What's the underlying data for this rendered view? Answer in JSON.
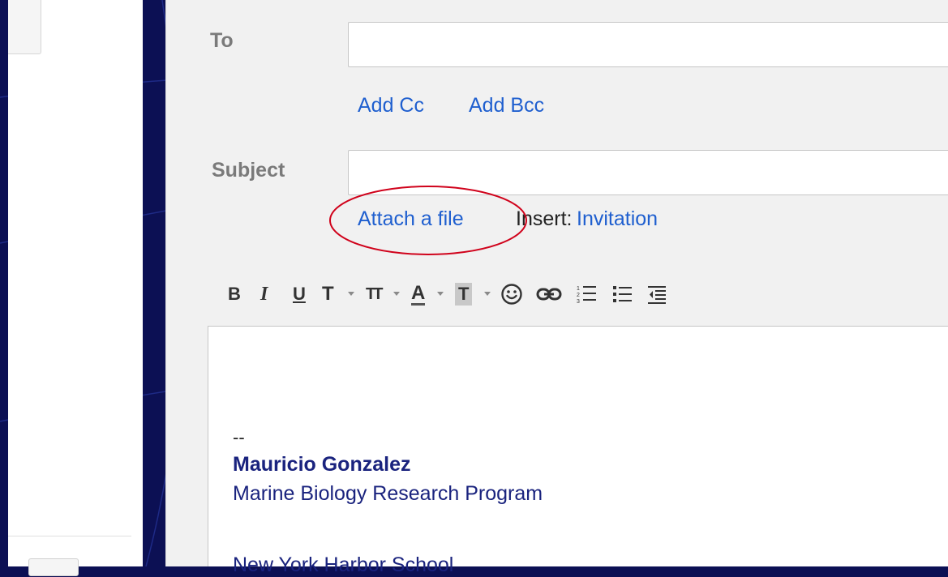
{
  "compose": {
    "to_label": "To",
    "subject_label": "Subject",
    "to_value": "",
    "subject_value": "",
    "add_cc": "Add Cc",
    "add_bcc": "Add Bcc",
    "attach_file": "Attach a file",
    "insert_label": "Insert:",
    "insert_invitation": "Invitation"
  },
  "toolbar": {
    "bold": "B",
    "italic": "I",
    "underline": "U",
    "font": "T",
    "size": "TT",
    "text_color": "A",
    "highlight": "T"
  },
  "signature": {
    "separator": "--",
    "name": "Mauricio Gonzalez",
    "program": "Marine Biology Research Program",
    "school": "New York Harbor School"
  },
  "colors": {
    "link": "#1f5fcf",
    "signature": "#1a237e",
    "annotation": "#d0021b",
    "slide_background": "#0c1054"
  },
  "icons": [
    "bold-icon",
    "italic-icon",
    "underline-icon",
    "font-icon",
    "font-size-icon",
    "text-color-icon",
    "highlight-icon",
    "emoji-icon",
    "link-icon",
    "numbered-list-icon",
    "bulleted-list-icon",
    "indent-icon"
  ]
}
